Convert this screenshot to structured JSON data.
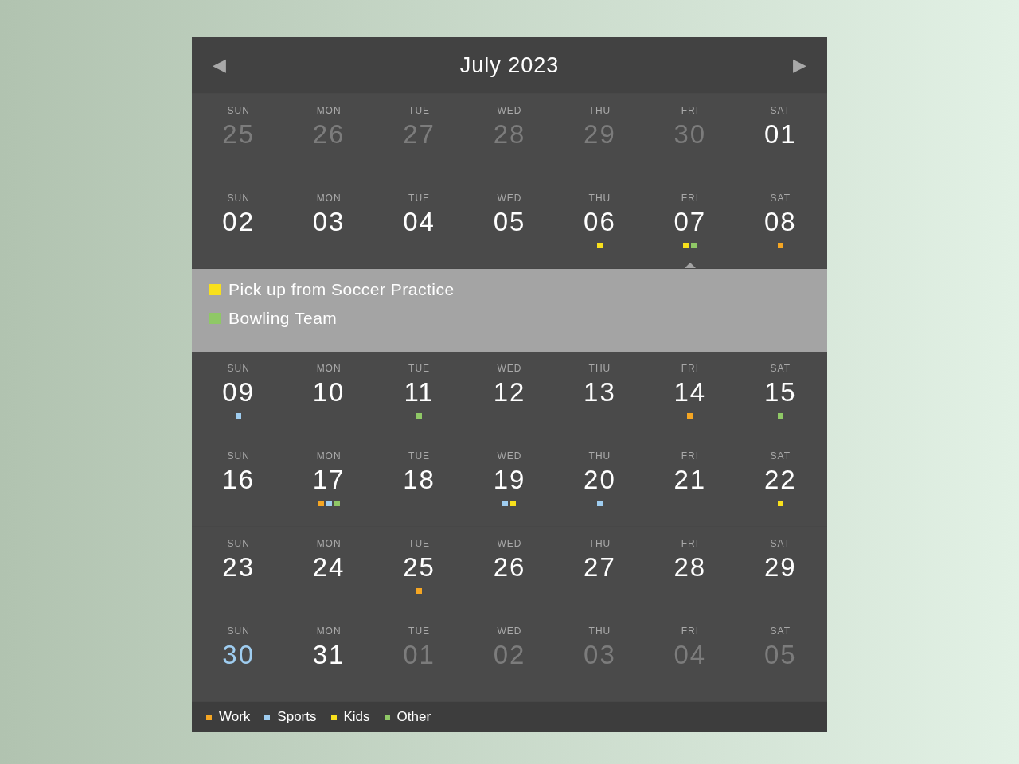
{
  "header": {
    "prev": "◀",
    "title": "July 2023",
    "next": "▶"
  },
  "weeks": [
    {
      "days": [
        {
          "weekday": "SUN",
          "day": "25",
          "kind": "outside"
        },
        {
          "weekday": "MON",
          "day": "26",
          "kind": "outside"
        },
        {
          "weekday": "TUE",
          "day": "27",
          "kind": "outside"
        },
        {
          "weekday": "WED",
          "day": "28",
          "kind": "outside"
        },
        {
          "weekday": "THU",
          "day": "29",
          "kind": "outside"
        },
        {
          "weekday": "FRI",
          "day": "30",
          "kind": "outside"
        },
        {
          "weekday": "SAT",
          "day": "01",
          "kind": "current"
        }
      ]
    },
    {
      "days": [
        {
          "weekday": "SUN",
          "day": "02",
          "kind": "current"
        },
        {
          "weekday": "MON",
          "day": "03",
          "kind": "current"
        },
        {
          "weekday": "TUE",
          "day": "04",
          "kind": "current"
        },
        {
          "weekday": "WED",
          "day": "05",
          "kind": "current"
        },
        {
          "weekday": "THU",
          "day": "06",
          "kind": "current",
          "events": [
            {
              "color": "#f8e01c"
            }
          ]
        },
        {
          "weekday": "FRI",
          "day": "07",
          "kind": "current",
          "events": [
            {
              "color": "#f8e01c"
            },
            {
              "color": "#8fc866"
            }
          ],
          "detail": [
            {
              "color": "#f8e01c",
              "title": "Pick up from Soccer Practice"
            },
            {
              "color": "#8fc866",
              "title": "Bowling Team"
            }
          ]
        },
        {
          "weekday": "SAT",
          "day": "08",
          "kind": "current",
          "events": [
            {
              "color": "#f5a623"
            }
          ]
        }
      ]
    },
    {
      "days": [
        {
          "weekday": "SUN",
          "day": "09",
          "kind": "current",
          "events": [
            {
              "color": "#9fcdf0"
            }
          ]
        },
        {
          "weekday": "MON",
          "day": "10",
          "kind": "current"
        },
        {
          "weekday": "TUE",
          "day": "11",
          "kind": "current",
          "events": [
            {
              "color": "#8fc866"
            }
          ]
        },
        {
          "weekday": "WED",
          "day": "12",
          "kind": "current"
        },
        {
          "weekday": "THU",
          "day": "13",
          "kind": "current"
        },
        {
          "weekday": "FRI",
          "day": "14",
          "kind": "current",
          "events": [
            {
              "color": "#f5a623"
            }
          ]
        },
        {
          "weekday": "SAT",
          "day": "15",
          "kind": "current",
          "events": [
            {
              "color": "#8fc866"
            }
          ]
        }
      ]
    },
    {
      "days": [
        {
          "weekday": "SUN",
          "day": "16",
          "kind": "current"
        },
        {
          "weekday": "MON",
          "day": "17",
          "kind": "current",
          "events": [
            {
              "color": "#f5a623"
            },
            {
              "color": "#9fcdf0"
            },
            {
              "color": "#8fc866"
            }
          ]
        },
        {
          "weekday": "TUE",
          "day": "18",
          "kind": "current"
        },
        {
          "weekday": "WED",
          "day": "19",
          "kind": "current",
          "events": [
            {
              "color": "#9fcdf0"
            },
            {
              "color": "#f8e01c"
            }
          ]
        },
        {
          "weekday": "THU",
          "day": "20",
          "kind": "current",
          "events": [
            {
              "color": "#9fcdf0"
            }
          ]
        },
        {
          "weekday": "FRI",
          "day": "21",
          "kind": "current"
        },
        {
          "weekday": "SAT",
          "day": "22",
          "kind": "current",
          "events": [
            {
              "color": "#f8e01c"
            }
          ]
        }
      ]
    },
    {
      "days": [
        {
          "weekday": "SUN",
          "day": "23",
          "kind": "current"
        },
        {
          "weekday": "MON",
          "day": "24",
          "kind": "current"
        },
        {
          "weekday": "TUE",
          "day": "25",
          "kind": "current",
          "events": [
            {
              "color": "#f5a623"
            }
          ]
        },
        {
          "weekday": "WED",
          "day": "26",
          "kind": "current"
        },
        {
          "weekday": "THU",
          "day": "27",
          "kind": "current"
        },
        {
          "weekday": "FRI",
          "day": "28",
          "kind": "current"
        },
        {
          "weekday": "SAT",
          "day": "29",
          "kind": "current"
        }
      ]
    },
    {
      "days": [
        {
          "weekday": "SUN",
          "day": "30",
          "kind": "today"
        },
        {
          "weekday": "MON",
          "day": "31",
          "kind": "current"
        },
        {
          "weekday": "TUE",
          "day": "01",
          "kind": "outside"
        },
        {
          "weekday": "WED",
          "day": "02",
          "kind": "outside"
        },
        {
          "weekday": "THU",
          "day": "03",
          "kind": "outside"
        },
        {
          "weekday": "FRI",
          "day": "04",
          "kind": "outside"
        },
        {
          "weekday": "SAT",
          "day": "05",
          "kind": "outside"
        }
      ]
    }
  ],
  "legend": [
    {
      "label": "Work",
      "color": "#f5a623"
    },
    {
      "label": "Sports",
      "color": "#9fcdf0"
    },
    {
      "label": "Kids",
      "color": "#f8e01c"
    },
    {
      "label": "Other",
      "color": "#8fc866"
    }
  ]
}
